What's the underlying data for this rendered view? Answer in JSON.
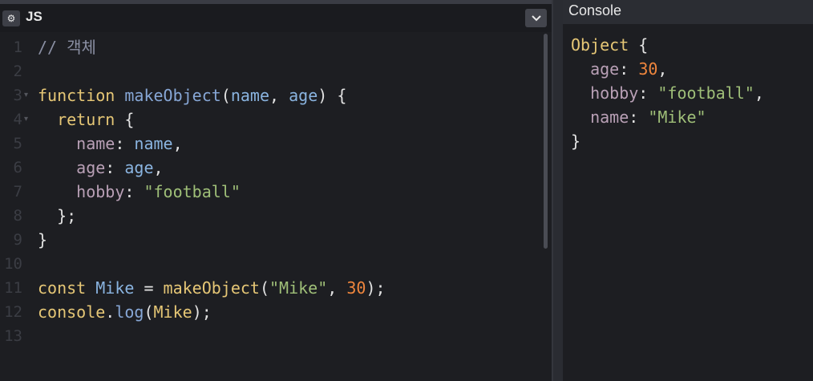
{
  "editor": {
    "title": "JS",
    "gear_icon": "⚙",
    "collapse_icon": "⌵",
    "lines": [
      {
        "n": "1",
        "tokens": [
          {
            "t": "// 객체",
            "c": "comment"
          }
        ]
      },
      {
        "n": "2",
        "tokens": []
      },
      {
        "n": "3",
        "fold": true,
        "tokens": [
          {
            "t": "function ",
            "c": "kw"
          },
          {
            "t": "makeObject",
            "c": "fn"
          },
          {
            "t": "(",
            "c": "pn"
          },
          {
            "t": "name",
            "c": "param"
          },
          {
            "t": ", ",
            "c": "pn"
          },
          {
            "t": "age",
            "c": "param"
          },
          {
            "t": ") {",
            "c": "pn"
          }
        ]
      },
      {
        "n": "4",
        "fold": true,
        "tokens": [
          {
            "t": "  return ",
            "c": "kw"
          },
          {
            "t": "{",
            "c": "pn"
          }
        ]
      },
      {
        "n": "5",
        "tokens": [
          {
            "t": "    name",
            "c": "prop"
          },
          {
            "t": ": ",
            "c": "pn"
          },
          {
            "t": "name",
            "c": "param"
          },
          {
            "t": ",",
            "c": "pn"
          }
        ]
      },
      {
        "n": "6",
        "tokens": [
          {
            "t": "    age",
            "c": "prop"
          },
          {
            "t": ": ",
            "c": "pn"
          },
          {
            "t": "age",
            "c": "param"
          },
          {
            "t": ",",
            "c": "pn"
          }
        ]
      },
      {
        "n": "7",
        "tokens": [
          {
            "t": "    hobby",
            "c": "prop"
          },
          {
            "t": ": ",
            "c": "pn"
          },
          {
            "t": "\"football\"",
            "c": "str"
          }
        ]
      },
      {
        "n": "8",
        "tokens": [
          {
            "t": "  };",
            "c": "pn"
          }
        ]
      },
      {
        "n": "9",
        "tokens": [
          {
            "t": "}",
            "c": "pn"
          }
        ]
      },
      {
        "n": "10",
        "tokens": []
      },
      {
        "n": "11",
        "tokens": [
          {
            "t": "const ",
            "c": "kw"
          },
          {
            "t": "Mike",
            "c": "param"
          },
          {
            "t": " = ",
            "c": "pn"
          },
          {
            "t": "makeObject",
            "c": "kw"
          },
          {
            "t": "(",
            "c": "pn"
          },
          {
            "t": "\"Mike\"",
            "c": "str"
          },
          {
            "t": ", ",
            "c": "pn"
          },
          {
            "t": "30",
            "c": "num"
          },
          {
            "t": ");",
            "c": "pn"
          }
        ]
      },
      {
        "n": "12",
        "tokens": [
          {
            "t": "console",
            "c": "kw"
          },
          {
            "t": ".",
            "c": "pn"
          },
          {
            "t": "log",
            "c": "fn"
          },
          {
            "t": "(",
            "c": "pn"
          },
          {
            "t": "Mike",
            "c": "kw"
          },
          {
            "t": ");",
            "c": "pn"
          }
        ]
      },
      {
        "n": "13",
        "tokens": []
      }
    ]
  },
  "console": {
    "title": "Console",
    "lines": [
      [
        {
          "t": "Object ",
          "c": "kw"
        },
        {
          "t": "{",
          "c": "pn"
        }
      ],
      [
        {
          "t": "  age",
          "c": "prop"
        },
        {
          "t": ": ",
          "c": "pn"
        },
        {
          "t": "30",
          "c": "num"
        },
        {
          "t": ",",
          "c": "pn"
        }
      ],
      [
        {
          "t": "  hobby",
          "c": "prop"
        },
        {
          "t": ": ",
          "c": "pn"
        },
        {
          "t": "\"football\"",
          "c": "str"
        },
        {
          "t": ",",
          "c": "pn"
        }
      ],
      [
        {
          "t": "  name",
          "c": "prop"
        },
        {
          "t": ": ",
          "c": "pn"
        },
        {
          "t": "\"Mike\"",
          "c": "str"
        }
      ],
      [
        {
          "t": "}",
          "c": "pn"
        }
      ]
    ]
  },
  "colors": {
    "background": "#1d1e22",
    "keyword": "#e6c776",
    "function": "#87a7d6",
    "string": "#9fbf78",
    "number": "#f0863d",
    "property": "#b9a0b6"
  }
}
